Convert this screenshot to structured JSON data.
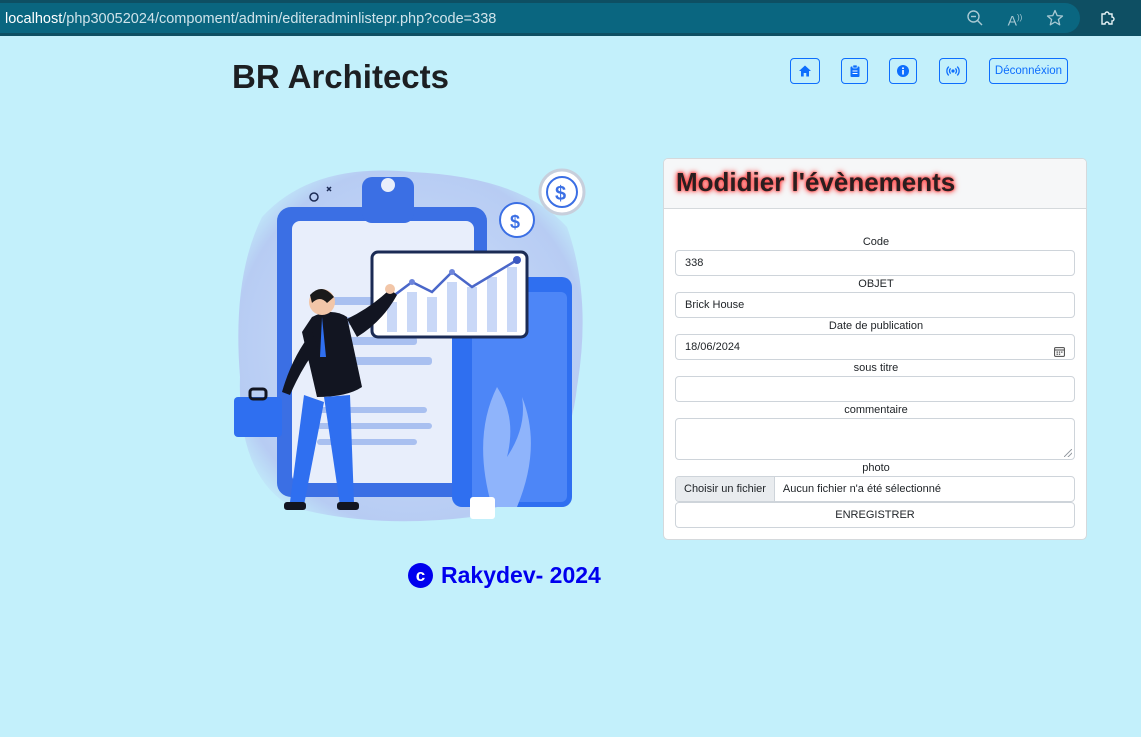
{
  "browser": {
    "url_host": "localhost",
    "url_path": "/php30052024/compoment/admin/editeradminlistepr.php?code=338"
  },
  "header": {
    "brand": "BR Architects",
    "nav": {
      "home_icon": "home-icon",
      "clipboard_icon": "clipboard-icon",
      "info_icon": "info-icon",
      "broadcast_icon": "broadcast-icon",
      "logout_label": "Déconnéxion"
    }
  },
  "form": {
    "title": "Modidier l'évènements",
    "code": {
      "label": "Code",
      "value": "338"
    },
    "objet": {
      "label": "OBJET",
      "value": "Brick House"
    },
    "date": {
      "label": "Date de publication",
      "value": "18/06/2024"
    },
    "sous_titre": {
      "label": "sous titre",
      "value": ""
    },
    "commentaire": {
      "label": "commentaire",
      "value": ""
    },
    "photo": {
      "label": "photo",
      "button": "Choisir un fichier",
      "filename": "Aucun fichier n'a été sélectionné"
    },
    "submit_label": "ENREGISTRER"
  },
  "footer": {
    "symbol": "c",
    "text": "Rakydev- 2024"
  },
  "colors": {
    "page_bg": "#c3f0fb",
    "accent": "#0d6efd",
    "footer": "#0000ee",
    "title_glow": "#ff3b3b"
  }
}
